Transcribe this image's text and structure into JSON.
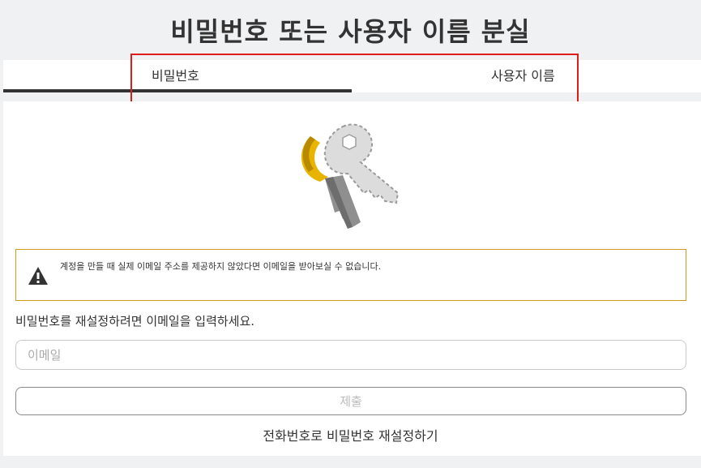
{
  "page": {
    "title": "비밀번호 또는 사용자 이름 분실"
  },
  "tabs": [
    {
      "label": "비밀번호",
      "active": true
    },
    {
      "label": "사용자 이름",
      "active": false
    }
  ],
  "illustration": {
    "icon": "keys-icon"
  },
  "notice": {
    "icon": "warning-icon",
    "text": "계정을 만들 때 실제 이메일 주소를 제공하지 않았다면 이메일을 받아보실 수 없습니다."
  },
  "form": {
    "instruction": "비밀번호를 재설정하려면 이메일을 입력하세요.",
    "email_placeholder": "이메일",
    "email_value": "",
    "submit_label": "제출"
  },
  "links": {
    "phone_reset": "전화번호로 비밀번호 재설정하기"
  },
  "colors": {
    "highlight_border": "#e01b1b",
    "notice_border": "#d39a1e",
    "active_tab_underline": "#333333"
  }
}
